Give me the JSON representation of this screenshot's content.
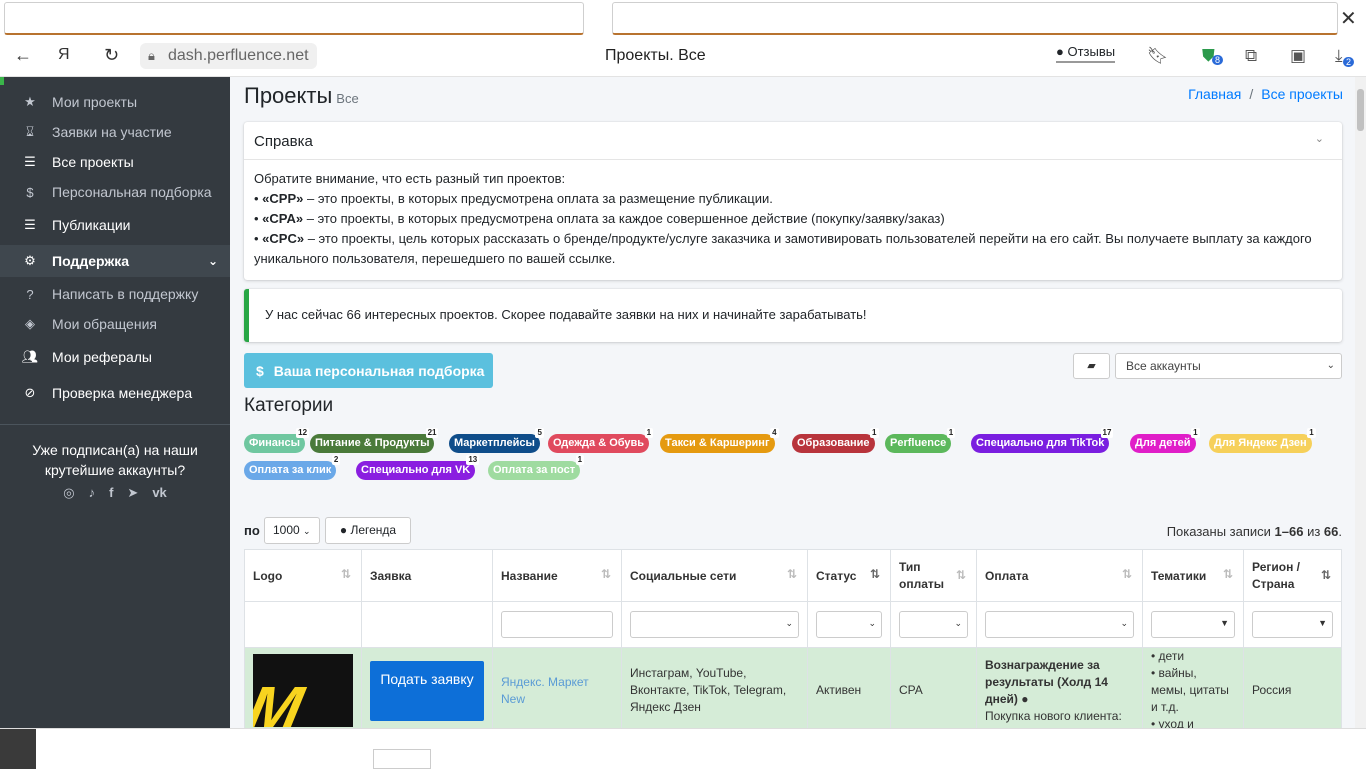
{
  "browser": {
    "url": "dash.perfluence.net",
    "title": "Проекты. Все",
    "reviews": "Отзывы",
    "badge_shield": "8",
    "badge_dl": "2"
  },
  "sidebar": {
    "items": [
      {
        "label": "Мои проекты",
        "icon": "star-icon"
      },
      {
        "label": "Заявки на участие",
        "icon": "hourglass-icon"
      },
      {
        "label": "Все проекты",
        "icon": "list-icon"
      },
      {
        "label": "Персональная подборка",
        "icon": "dollar-icon"
      },
      {
        "label": "Публикации",
        "icon": "list-icon"
      },
      {
        "label": "Поддержка",
        "icon": "gear-icon"
      },
      {
        "label": "Написать в поддержку",
        "icon": "question-icon"
      },
      {
        "label": "Мои обращения",
        "icon": "ticket-icon"
      },
      {
        "label": "Мои рефералы",
        "icon": "users-icon"
      },
      {
        "label": "Проверка менеджера",
        "icon": "check-circle-icon"
      }
    ],
    "promo": "Уже подписан(а) на наши крутейшие аккаунты?"
  },
  "page": {
    "title": "Проекты",
    "subtitle": "Все",
    "bc_home": "Главная",
    "bc_current": "Все проекты"
  },
  "help": {
    "title": "Справка",
    "intro": "Обратите внимание, что есть разный тип проектов:",
    "cpp_name": "«CPP»",
    "cpp_text": " – это проекты, в которых предусмотрена оплата за размещение публикации.",
    "cpa_name": "«CPA»",
    "cpa_text": " – это проекты, в которых предусмотрена оплата за каждое совершенное действие (покупку/заявку/заказ)",
    "cpc_name": "«CPC»",
    "cpc_text": " – это проекты, цель которых рассказать о бренде/продукте/услуге заказчика и замотивировать пользователей перейти на его сайт. Вы получаете выплату за каждого уникального пользователя, перешедшего по вашей ссылке."
  },
  "alert": "У нас сейчас 66 интересных проектов. Скорее подавайте заявки на них и начинайте зарабатывать!",
  "personal_btn": "Ваша персональная подборка",
  "accounts_select": "Все аккаунты",
  "categories_title": "Категории",
  "categories": [
    {
      "label": "Финансы",
      "count": "12",
      "color": "#6fc7a0"
    },
    {
      "label": "Питание & Продукты",
      "count": "21",
      "color": "#4a7a3a"
    },
    {
      "label": "Маркетплейсы",
      "count": "5",
      "color": "#0f4d8a"
    },
    {
      "label": "Одежда & Обувь",
      "count": "1",
      "color": "#e04a5e"
    },
    {
      "label": "Такси & Каршеринг",
      "count": "4",
      "color": "#e59a10"
    },
    {
      "label": "Образование",
      "count": "1",
      "color": "#b8343c"
    },
    {
      "label": "Perfluence",
      "count": "1",
      "color": "#5cb85c"
    },
    {
      "label": "Специально для TikTok",
      "count": "17",
      "color": "#7a1ee0"
    },
    {
      "label": "Для детей",
      "count": "1",
      "color": "#e01ec8"
    },
    {
      "label": "Для Яндекс Дзен",
      "count": "1",
      "color": "#f6d05a"
    },
    {
      "label": "Оплата за клик",
      "count": "2",
      "color": "#6aa8e8"
    },
    {
      "label": "Специально для VK",
      "count": "13",
      "color": "#8a1ee0"
    },
    {
      "label": "Оплата за пост",
      "count": "1",
      "color": "#9fdba0"
    }
  ],
  "table_ctrl": {
    "per": "по",
    "per_value": "1000",
    "legend": "Легенда",
    "shown_prefix": "Показаны записи ",
    "shown_range": "1–66",
    "shown_mid": " из ",
    "shown_total": "66",
    "shown_end": "."
  },
  "columns": [
    "Logo",
    "Заявка",
    "Название",
    "Социальные сети",
    "Статус",
    "Тип оплаты",
    "Оплата",
    "Тематики",
    "Регион / Страна"
  ],
  "row": {
    "apply": "Подать заявку",
    "name": "Яндекс. Маркет New",
    "social": "Инстаграм, YouTube, Вконтакте, TikTok, Telegram, Яндекс Дзен",
    "status": "Активен",
    "pay_type": "CPA",
    "pay_title": "Вознаграждение за результаты (Холд 14 дней)",
    "pay_text": "Покупка нового клиента:",
    "themes": [
      "дети",
      "вайны, мемы, цитаты и т.д.",
      "уход и"
    ],
    "region": "Россия"
  }
}
